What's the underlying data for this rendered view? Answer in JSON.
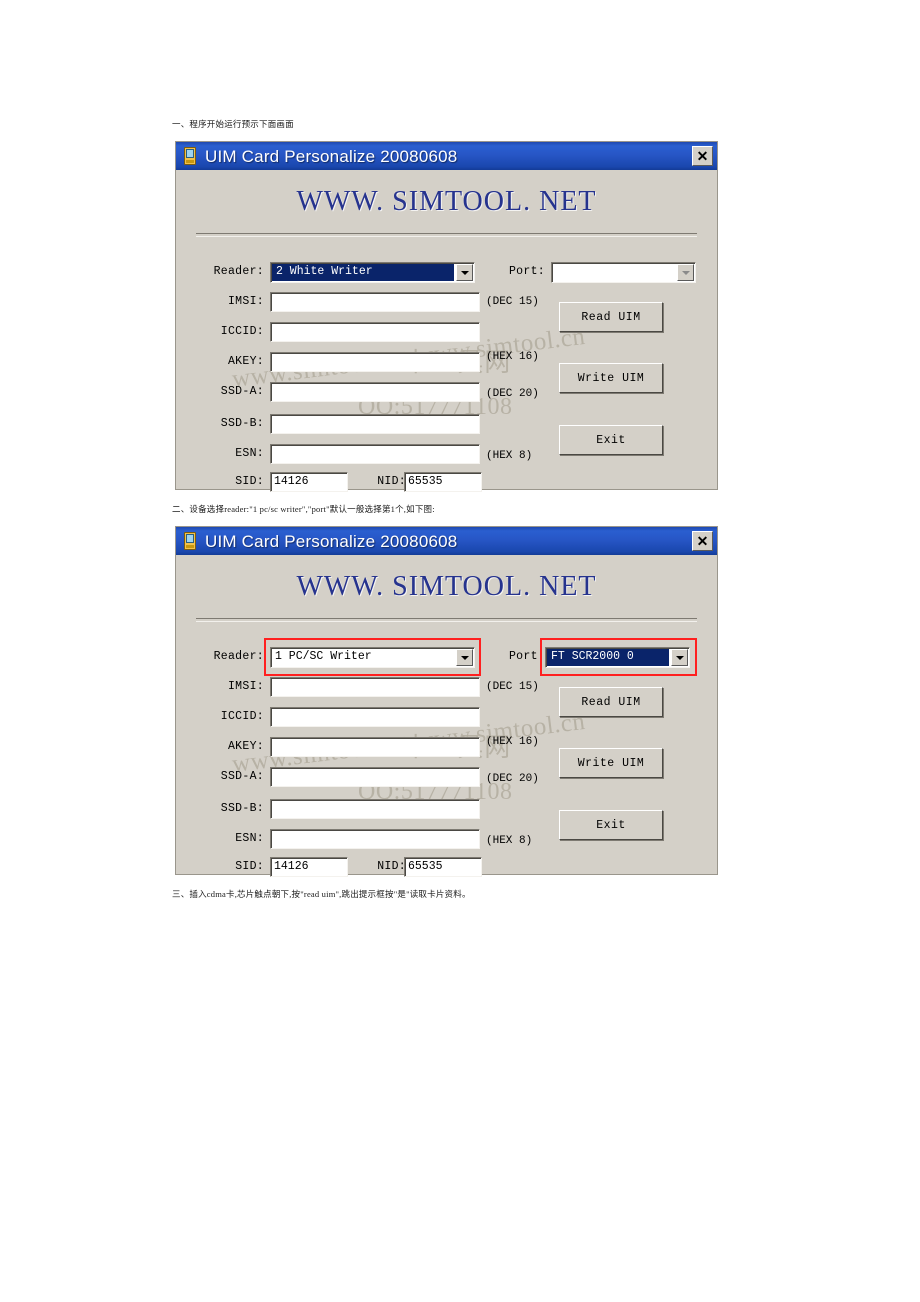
{
  "document": {
    "captions": [
      "一、程序开始运行预示下面画面",
      "二、设备选择reader:\"1 pc/sc writer\",\"port\"默认一般选择第1个,如下图:",
      "三、插入cdma卡,芯片触点朝下,按\"read uim\",跳出提示框按\"是\"读取卡片资料。"
    ]
  },
  "colors": {
    "titlebar_blue": "#2756c6",
    "dialog_face": "#d4d0c8",
    "brand_navy": "#26338e",
    "highlight_blue": "#0a246a",
    "annotation_red": "#ff2020"
  },
  "dialog": {
    "title": "UIM Card Personalize  20080608",
    "icon": "pda-device-icon",
    "close_label": "✕",
    "close_icon": "close-icon",
    "brand": "WWW. SIMTOOL. NET",
    "labels": {
      "reader": "Reader:",
      "port": "Port:",
      "imsi": "IMSI:",
      "iccid": "ICCID:",
      "akey": "AKEY:",
      "ssd_a": "SSD-A:",
      "ssd_b": "SSD-B:",
      "esn": "ESN:",
      "sid": "SID:",
      "nid": "NID:"
    },
    "hints": {
      "imsi": "(DEC 15)",
      "akey": "(HEX 16)",
      "ssd_a": "(DEC 20)",
      "esn": "(HEX 8)"
    },
    "buttons": {
      "read": "Read UIM",
      "write": "Write UIM",
      "exit": "Exit"
    },
    "values": {
      "imsi": "",
      "iccid": "",
      "akey": "",
      "ssd_a": "",
      "ssd_b": "",
      "esn": "",
      "sid": "14126",
      "nid": "65535"
    }
  },
  "screen_one": {
    "reader_value": "2 White Writer",
    "port_value": ""
  },
  "screen_two": {
    "reader_value": "1 PC/SC Writer",
    "port_value": "FT SCR2000 0"
  },
  "watermark": {
    "line1": "SIM卡工具网",
    "line2": "www.simtool.net www.simtool.cn",
    "line3": "QQ:517771108",
    "line4": "www. simtool.net"
  }
}
